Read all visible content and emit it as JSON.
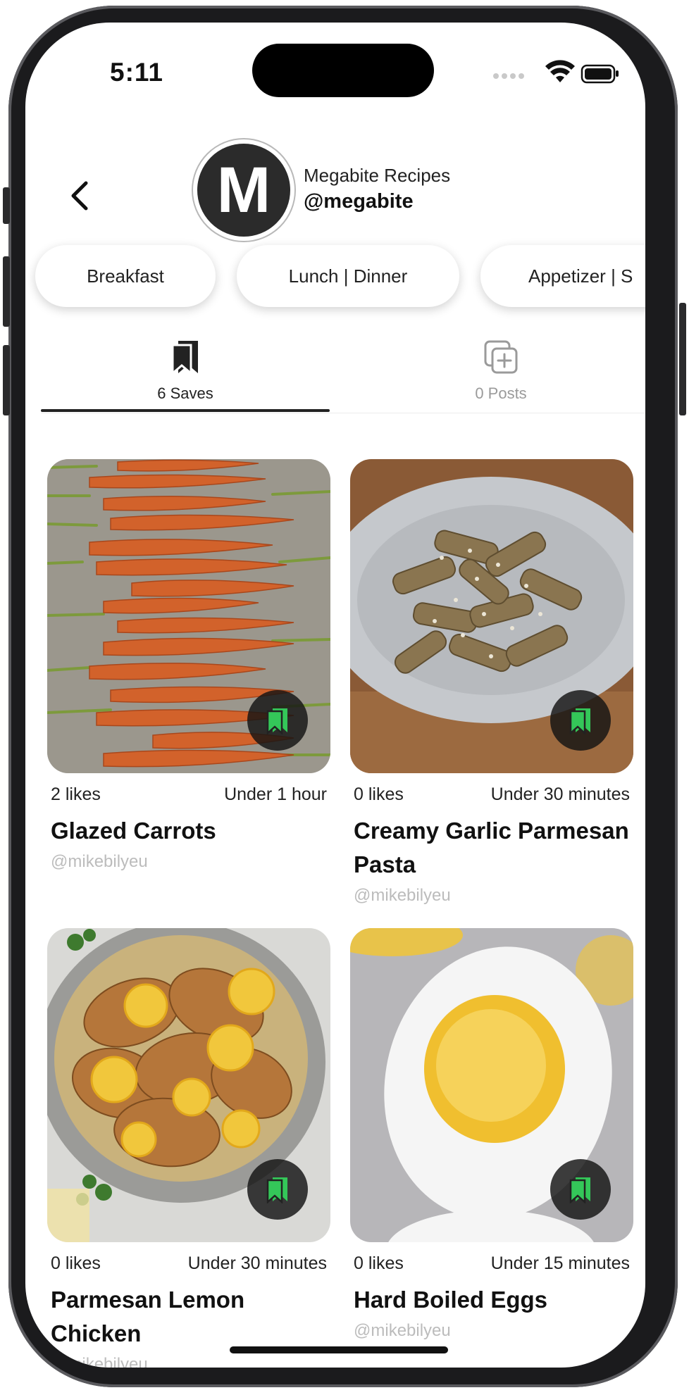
{
  "status_bar": {
    "time": "5:11"
  },
  "profile": {
    "avatar_letter": "M",
    "name": "Megabite Recipes",
    "handle": "@megabite"
  },
  "categories": [
    "Breakfast",
    "Lunch | Dinner",
    "Appetizer | S"
  ],
  "tabs": [
    {
      "label": "6 Saves",
      "icon": "bookmarks-icon",
      "active": true
    },
    {
      "label": "0 Posts",
      "icon": "add-post-icon",
      "active": false
    }
  ],
  "recipes": [
    {
      "likes": "2 likes",
      "time": "Under 1 hour",
      "title": "Glazed Carrots",
      "author": "@mikebilyeu",
      "image": "glazed-carrots-photo"
    },
    {
      "likes": "0 likes",
      "time": "Under 30 minutes",
      "title": "Creamy Garlic Parmesan Pasta",
      "author": "@mikebilyeu",
      "image": "creamy-pasta-photo"
    },
    {
      "likes": "0 likes",
      "time": "Under 30 minutes",
      "title": "Parmesan Lemon Chicken",
      "author": "@mikebilyeu",
      "image": "lemon-chicken-photo"
    },
    {
      "likes": "0 likes",
      "time": "Under 15 minutes",
      "title": "Hard Boiled Eggs",
      "author": "@mikebilyeu",
      "image": "hard-boiled-egg-photo"
    }
  ],
  "colors": {
    "accent_green": "#34c759",
    "active_text": "#222222",
    "inactive_text": "#9a9a9a",
    "handle_gray": "#bcbcbc"
  }
}
